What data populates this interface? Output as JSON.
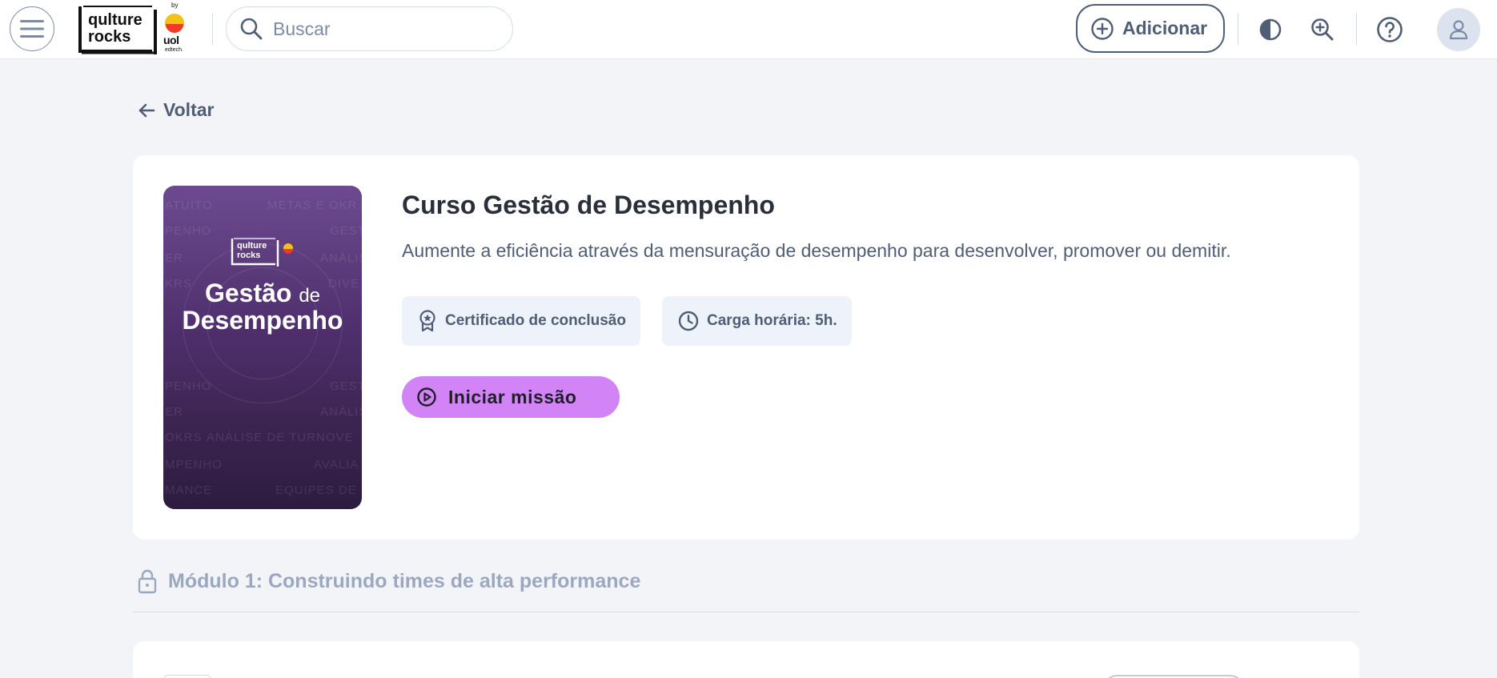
{
  "header": {
    "logo": {
      "line1": "qulture",
      "line2": "rocks",
      "by": "by",
      "partner": "uol",
      "partner_sub": "edtech."
    },
    "search": {
      "placeholder": "Buscar"
    },
    "add_label": "Adicionar",
    "icons": [
      "menu-icon",
      "search-icon",
      "plus-circle-icon",
      "contrast-icon",
      "zoom-in-icon",
      "help-icon",
      "user-icon"
    ]
  },
  "back": {
    "label": "Voltar"
  },
  "course": {
    "title": "Curso Gestão de Desempenho",
    "description": "Aumente a eficiência através da mensuração de desempenho para desenvolver, promover ou demitir.",
    "cover": {
      "title_part1": "Gestão",
      "title_part2": "de",
      "title_line2": "Desempenho",
      "logo_line1": "qulture",
      "logo_line2": "rocks",
      "background_words": [
        "ATUITO",
        "METAS E OKR",
        "PENHO",
        "GEST",
        "ER",
        "ANÁLIS",
        "KRS",
        "DIVE",
        "PENHO",
        "GEST",
        "ER",
        "ANÁLIS",
        "OKRS",
        "ANÁLISE DE TURNOVE",
        "MPENHO",
        "AVALIA",
        "MANCE",
        "EQUIPES DE"
      ]
    },
    "chips": [
      {
        "label": "Certificado de conclusão",
        "icon": "badge-icon"
      },
      {
        "label": "Carga horária: 5h.",
        "icon": "clock-icon"
      }
    ],
    "start_label": "Iniciar missão"
  },
  "module": {
    "label": "Módulo 1: Construindo times de alta performance",
    "icon": "lock-icon"
  },
  "colors": {
    "accent_button": "#d283f5",
    "text_primary": "#2b2f3a",
    "text_secondary": "#4f5d75",
    "muted": "#9aa8c0",
    "chip_bg": "#eef3fb",
    "page_bg": "#f3f4f7",
    "cover_purple": "#4e2f6c"
  }
}
